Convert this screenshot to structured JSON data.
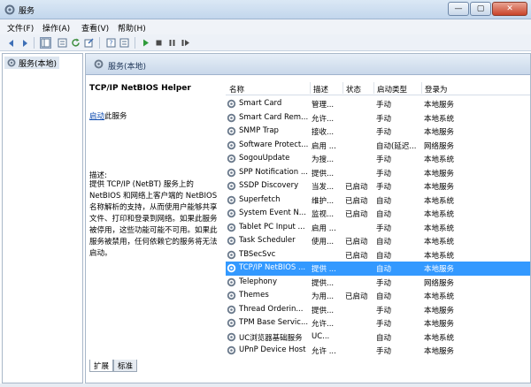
{
  "window": {
    "title": "服务",
    "min_glyph": "—",
    "max_glyph": "▢",
    "close_glyph": "✕"
  },
  "menu": [
    "文件(F)",
    "操作(A)",
    "查看(V)",
    "帮助(H)"
  ],
  "toolbar_icons": [
    "back-icon",
    "forward-icon",
    "console-tree-icon",
    "properties-icon",
    "refresh-icon",
    "export-icon",
    "help-icon",
    "help-topics-icon",
    "start-icon",
    "stop-icon",
    "pause-icon",
    "restart-icon"
  ],
  "tree": {
    "item": "服务(本地)"
  },
  "pane": {
    "header": "服务(本地)"
  },
  "detail": {
    "service_title": "TCP/IP NetBIOS Helper",
    "start_link": "启动",
    "start_suffix": "此服务",
    "desc_label": "描述:",
    "desc_text": "提供 TCP/IP (NetBT) 服务上的 NetBIOS 和网络上客户端的 NetBIOS 名称解析的支持，从而使用户能够共享文件、打印和登录到网络。如果此服务被停用，这些功能可能不可用。如果此服务被禁用，任何依赖它的服务将无法启动。"
  },
  "columns": [
    "名称",
    "描述",
    "状态",
    "启动类型",
    "登录为"
  ],
  "rows": [
    {
      "name": "Smart Card",
      "desc": "管理...",
      "status": "",
      "start": "手动",
      "logon": "本地服务"
    },
    {
      "name": "Smart Card Rem...",
      "desc": "允许...",
      "status": "",
      "start": "手动",
      "logon": "本地系统"
    },
    {
      "name": "SNMP Trap",
      "desc": "接收...",
      "status": "",
      "start": "手动",
      "logon": "本地服务"
    },
    {
      "name": "Software Protect...",
      "desc": "启用 ...",
      "status": "",
      "start": "自动(延迟...",
      "logon": "网络服务"
    },
    {
      "name": "SogouUpdate",
      "desc": "为搜...",
      "status": "",
      "start": "手动",
      "logon": "本地系统"
    },
    {
      "name": "SPP Notification ...",
      "desc": "提供...",
      "status": "",
      "start": "手动",
      "logon": "本地服务"
    },
    {
      "name": "SSDP Discovery",
      "desc": "当发...",
      "status": "已启动",
      "start": "手动",
      "logon": "本地服务"
    },
    {
      "name": "Superfetch",
      "desc": "维护...",
      "status": "已启动",
      "start": "自动",
      "logon": "本地系统"
    },
    {
      "name": "System Event N...",
      "desc": "监视...",
      "status": "已启动",
      "start": "自动",
      "logon": "本地系统"
    },
    {
      "name": "Tablet PC Input ...",
      "desc": "启用 ...",
      "status": "",
      "start": "手动",
      "logon": "本地系统"
    },
    {
      "name": "Task Scheduler",
      "desc": "使用...",
      "status": "已启动",
      "start": "自动",
      "logon": "本地系统"
    },
    {
      "name": "TBSecSvc",
      "desc": "",
      "status": "已启动",
      "start": "自动",
      "logon": "本地系统"
    },
    {
      "name": "TCP/IP NetBIOS ...",
      "desc": "提供 ...",
      "status": "",
      "start": "自动",
      "logon": "本地服务",
      "selected": true
    },
    {
      "name": "Telephony",
      "desc": "提供...",
      "status": "",
      "start": "手动",
      "logon": "网络服务"
    },
    {
      "name": "Themes",
      "desc": "为用...",
      "status": "已启动",
      "start": "自动",
      "logon": "本地系统"
    },
    {
      "name": "Thread Orderin...",
      "desc": "提供...",
      "status": "",
      "start": "手动",
      "logon": "本地服务"
    },
    {
      "name": "TPM Base Servic...",
      "desc": "允许...",
      "status": "",
      "start": "手动",
      "logon": "本地服务"
    },
    {
      "name": "UC浏览器基础服务",
      "desc": "UC...",
      "status": "",
      "start": "自动",
      "logon": "本地系统"
    },
    {
      "name": "UPnP Device Host",
      "desc": "允许 ...",
      "status": "",
      "start": "手动",
      "logon": "本地服务"
    }
  ],
  "tabs": [
    "扩展",
    "标准"
  ],
  "colors": {
    "selection": "#3399ff",
    "gear": "#6b7a8c",
    "link": "#0645ad"
  }
}
